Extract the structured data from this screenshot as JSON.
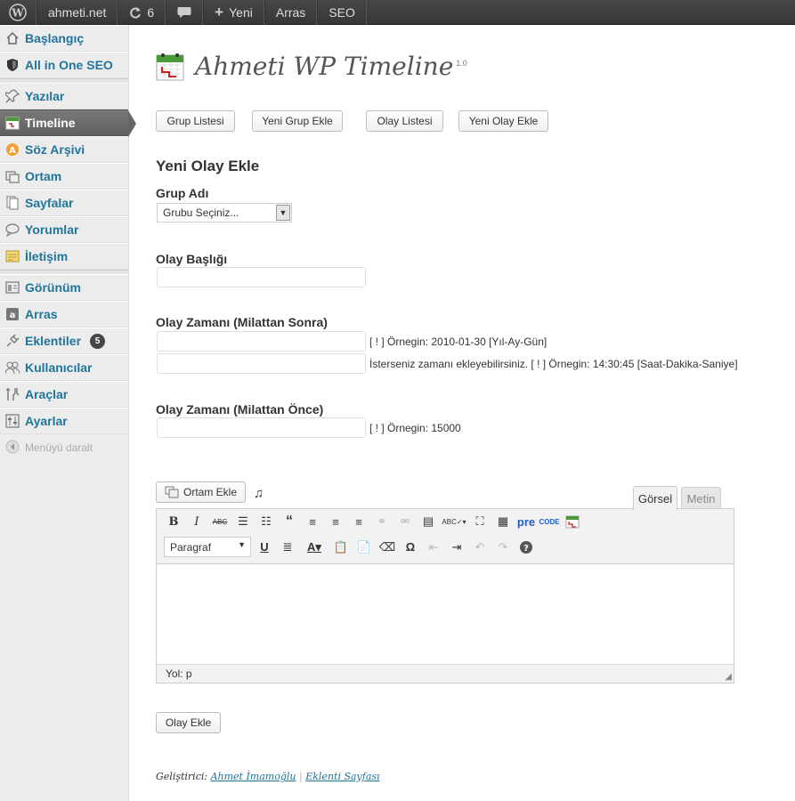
{
  "adminbar": {
    "site": "ahmeti.net",
    "updates": "6",
    "new_label": "Yeni",
    "arras": "Arras",
    "seo": "SEO"
  },
  "sidebar": {
    "items": [
      {
        "label": "Başlangıç",
        "icon": "home-icon"
      },
      {
        "label": "All in One SEO",
        "icon": "shield-icon"
      },
      {
        "label": "Yazılar",
        "icon": "pin-icon"
      },
      {
        "label": "Timeline",
        "icon": "timeline-icon"
      },
      {
        "label": "Söz Arşivi",
        "icon": "quote-archive-icon"
      },
      {
        "label": "Ortam",
        "icon": "media-icon"
      },
      {
        "label": "Sayfalar",
        "icon": "pages-icon"
      },
      {
        "label": "Yorumlar",
        "icon": "comments-icon"
      },
      {
        "label": "İletişim",
        "icon": "contact-icon"
      },
      {
        "label": "Görünüm",
        "icon": "appearance-icon"
      },
      {
        "label": "Arras",
        "icon": "arras-icon"
      },
      {
        "label": "Eklentiler",
        "icon": "plugins-icon",
        "badge": "5"
      },
      {
        "label": "Kullanıcılar",
        "icon": "users-icon"
      },
      {
        "label": "Araçlar",
        "icon": "tools-icon"
      },
      {
        "label": "Ayarlar",
        "icon": "settings-icon"
      }
    ],
    "collapse": "Menüyü daralt"
  },
  "header": {
    "title": "Ahmeti WP Timeline",
    "version": "1.0"
  },
  "buttons": {
    "group_list": "Grup Listesi",
    "new_group": "Yeni Grup Ekle",
    "event_list": "Olay Listesi",
    "new_event": "Yeni Olay Ekle"
  },
  "form": {
    "heading": "Yeni Olay Ekle",
    "group_label": "Grup Adı",
    "group_select": "Grubu Seçiniz...",
    "title_label": "Olay Başlığı",
    "title_value": "",
    "ad_label": "Olay Zamanı (Milattan Sonra)",
    "ad_date_value": "",
    "ad_date_hint": "[ ! ] Örnegin: 2010-01-30 [Yıl-Ay-Gün]",
    "ad_time_value": "",
    "ad_time_hint": "İsterseniz zamanı ekleyebilirsiniz. [ ! ] Örnegin: 14:30:45 [Saat-Dakika-Saniye]",
    "bc_label": "Olay Zamanı (Milattan Önce)",
    "bc_value": "",
    "bc_hint": "[ ! ] Örnegin: 15000",
    "submit": "Olay Ekle"
  },
  "editor": {
    "media_button": "Ortam Ekle",
    "tab_visual": "Görsel",
    "tab_text": "Metin",
    "format_select": "Paragraf",
    "path": "Yol: p",
    "pre": "pre",
    "code": "CODE"
  },
  "footer": {
    "developer_label": "Geliştirici:",
    "developer": "Ahmet İmamoğlu",
    "separator": "|",
    "plugin_page": "Eklenti Sayfası"
  }
}
